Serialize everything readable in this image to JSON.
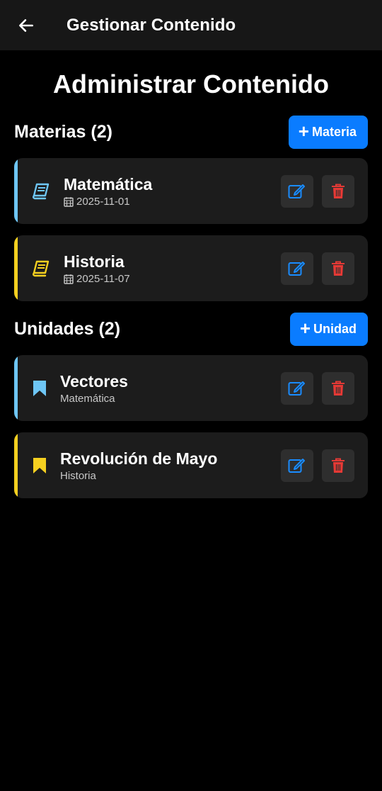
{
  "appbar": {
    "title": "Gestionar Contenido"
  },
  "page": {
    "title": "Administrar Contenido"
  },
  "materias": {
    "header": "Materias (2)",
    "add_label": "Materia",
    "items": [
      {
        "title": "Matemática",
        "date": "2025-11-01",
        "color": "#6ec6f5"
      },
      {
        "title": "Historia",
        "date": "2025-11-07",
        "color": "#f5d020"
      }
    ]
  },
  "unidades": {
    "header": "Unidades (2)",
    "add_label": "Unidad",
    "items": [
      {
        "title": "Vectores",
        "subject": "Matemática",
        "color": "#6ec6f5"
      },
      {
        "title": "Revolución de Mayo",
        "subject": "Historia",
        "color": "#f5d020"
      }
    ]
  },
  "colors": {
    "accent": "#0a7cff",
    "edit": "#1a8cff",
    "delete": "#e53935",
    "card": "#1c1c1c"
  }
}
